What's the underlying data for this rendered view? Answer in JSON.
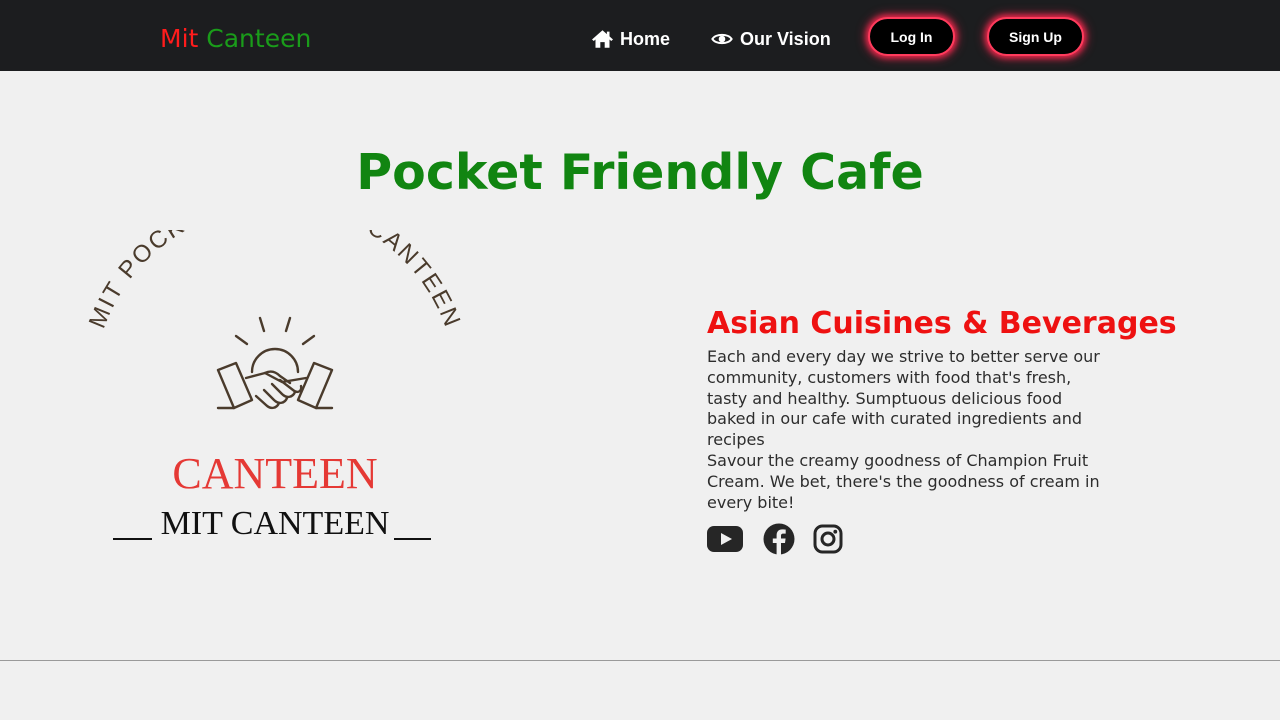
{
  "brand": {
    "part1": "Mit",
    "part2": "Canteen"
  },
  "nav": {
    "home_label": "Home",
    "vision_label": "Our Vision",
    "login_label": "Log In",
    "signup_label": "Sign Up"
  },
  "hero": {
    "title": "Pocket Friendly Cafe"
  },
  "logo": {
    "arc_text": "MIT POCKET FRIENDLY CANTEEN",
    "main_text": "CANTEEN",
    "sub_text": "MIT CANTEEN"
  },
  "section": {
    "heading": "Asian Cuisines & Beverages",
    "paragraph1": "Each and every day we strive to better serve our community, customers with food that's fresh, tasty and healthy. Sumptuous delicious food baked in our cafe with curated ingredients and recipes",
    "paragraph2": "Savour the creamy goodness of Champion Fruit Cream. We bet, there's the goodness of cream in every bite!"
  },
  "social": {
    "icons": [
      "youtube-icon",
      "facebook-icon",
      "instagram-icon"
    ]
  },
  "colors": {
    "navbar_bg": "#1c1d1f",
    "brand_red": "#ff1c1c",
    "brand_green": "#1a9c1a",
    "hero_green": "#118511",
    "heading_red": "#ee1111",
    "button_glow": "#ff3b5c",
    "logo_red": "#e53935",
    "logo_brown": "#4a3b2c"
  }
}
